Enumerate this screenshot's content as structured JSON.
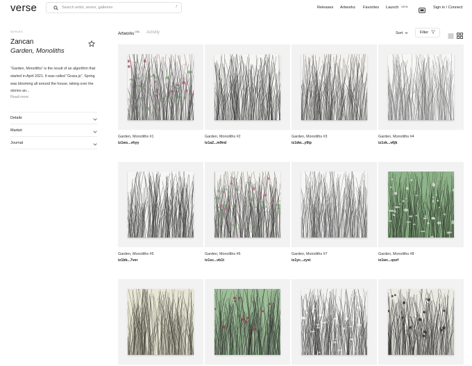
{
  "header": {
    "logo": "verse",
    "search_placeholder": "Search artist, series, galleries",
    "search_shortcut": "/",
    "nav": [
      {
        "label": "Releases"
      },
      {
        "label": "Artworks"
      },
      {
        "label": "Favorites"
      },
      {
        "label": "Launch",
        "badge": "NEW"
      }
    ],
    "sign_in": "Sign in / Connect"
  },
  "sidebar": {
    "section_label": "SERIES",
    "artist": "Zancan",
    "series": "Garden, Monoliths",
    "description": "“Garden, Monoliths” is the result of an algorithm that started in April 2021. It was called “Grass.js”. Spring was blooming all around the house, taking over the stones an...",
    "read_more": "Read more",
    "accordions": [
      {
        "label": "Details"
      },
      {
        "label": "Market"
      },
      {
        "label": "Journal"
      }
    ]
  },
  "main": {
    "tabs": {
      "artworks": "Artworks",
      "artworks_count": "256",
      "activity": "Activity"
    },
    "sort_label": "Sort",
    "filter_label": "Filter",
    "cards": [
      {
        "title": "Garden, Monoliths #1",
        "id": "tz1ws...vhyy",
        "bg": "#f4f3f0",
        "ink": "#3b3b3b",
        "accent": "#5b8d57",
        "flower": "#b0566a"
      },
      {
        "title": "Garden, Monoliths #2",
        "id": "tz1a2...m9nd",
        "bg": "#f6f6f4",
        "ink": "#2e2e2e",
        "accent": "",
        "flower": ""
      },
      {
        "title": "Garden, Monoliths #3",
        "id": "tz1dw...y9ip",
        "bg": "#f3f2ee",
        "ink": "#3a3a3a",
        "accent": "",
        "flower": ""
      },
      {
        "title": "Garden, Monoliths #4",
        "id": "tz1xk...v6jk",
        "bg": "#f7f7f6",
        "ink": "#6f6f6f",
        "accent": "",
        "flower": ""
      },
      {
        "title": "Garden, Monoliths #5",
        "id": "tz1bb...7ver",
        "bg": "#f6f6f4",
        "ink": "#2b2b2b",
        "accent": "",
        "flower": ""
      },
      {
        "title": "Garden, Monoliths #6",
        "id": "tz1sc...vb1t",
        "bg": "#f4f3ef",
        "ink": "#303030",
        "accent": "#6c9a62",
        "flower": "#b2727f"
      },
      {
        "title": "Garden, Monoliths #7",
        "id": "tz1yc...zyst",
        "bg": "#f6f6f5",
        "ink": "#4a4a4a",
        "accent": "",
        "flower": ""
      },
      {
        "title": "Garden, Monoliths #8",
        "id": "tz1wc...qozf",
        "bg": "#8fb38a",
        "ink": "#2d3a2b",
        "accent": "#ffffff",
        "flower": "#e6e6e0"
      },
      {
        "title": "",
        "id": "",
        "bg": "#e8e6d4",
        "ink": "#3a3a30",
        "accent": "",
        "flower": ""
      },
      {
        "title": "",
        "id": "",
        "bg": "#9dbf98",
        "ink": "#2b2b2b",
        "accent": "",
        "flower": "#8f3a4a"
      },
      {
        "title": "",
        "id": "",
        "bg": "#f2f2f0",
        "ink": "#333333",
        "accent": "#ffffff",
        "flower": ""
      },
      {
        "title": "",
        "id": "",
        "bg": "#ecebe3",
        "ink": "#222222",
        "accent": "",
        "flower": "#2a2a2a"
      }
    ]
  }
}
